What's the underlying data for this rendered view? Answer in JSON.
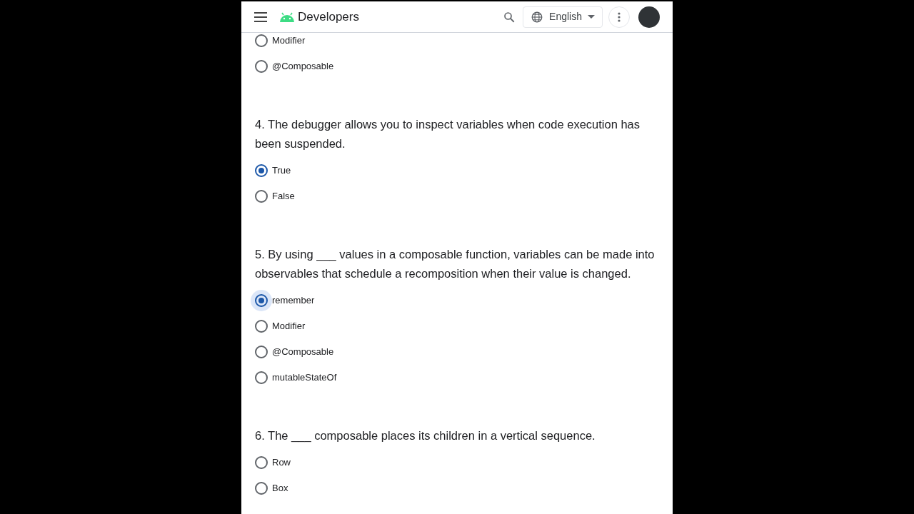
{
  "header": {
    "brand": "Developers",
    "language": "English"
  },
  "questions": [
    {
      "options": [
        {
          "label": "Modifier",
          "selected": false,
          "focused": false
        },
        {
          "label": "@Composable",
          "selected": false,
          "focused": false
        }
      ]
    },
    {
      "text": "4. The debugger allows you to inspect variables when code execution has been suspended.",
      "options": [
        {
          "label": "True",
          "selected": true,
          "focused": false
        },
        {
          "label": "False",
          "selected": false,
          "focused": false
        }
      ]
    },
    {
      "text": "5. By using ___ values in a composable function, variables can be made into observables that schedule a recomposition when their value is changed.",
      "options": [
        {
          "label": "remember",
          "selected": true,
          "focused": true
        },
        {
          "label": "Modifier",
          "selected": false,
          "focused": false
        },
        {
          "label": "@Composable",
          "selected": false,
          "focused": false
        },
        {
          "label": "mutableStateOf",
          "selected": false,
          "focused": false
        }
      ]
    },
    {
      "text": "6. The ___ composable places its children in a vertical sequence.",
      "options": [
        {
          "label": "Row",
          "selected": false,
          "focused": false
        },
        {
          "label": "Box",
          "selected": false,
          "focused": false
        }
      ]
    }
  ]
}
